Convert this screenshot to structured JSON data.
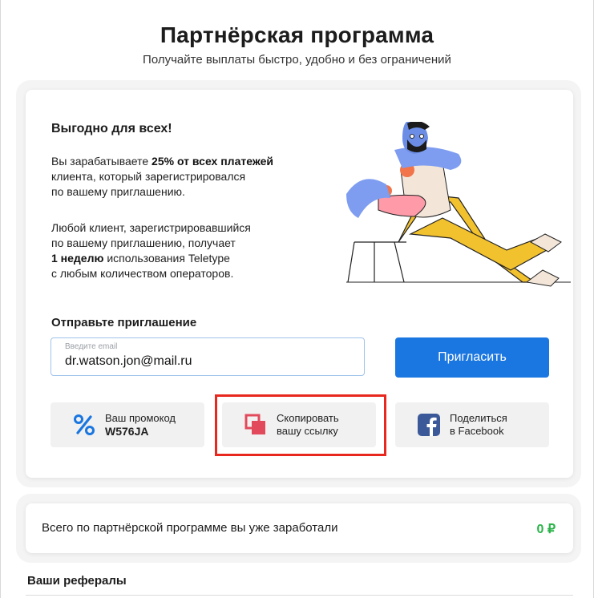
{
  "header": {
    "title": "Партнёрская программа",
    "subtitle": "Получайте выплаты быстро, удобно и без ограничений"
  },
  "benefit": {
    "title": "Выгодно для всех!",
    "p1_before": "Вы зарабатываете ",
    "p1_bold": "25% от всех платежей",
    "p1_after": "\nклиента, который зарегистрировался\nпо вашему приглашению.",
    "p2_before": "Любой клиент, зарегистрировавшийся\nпо вашему приглашению, получает\n",
    "p2_bold": "1 неделю",
    "p2_after": " использования Teletype\nс любым количеством операторов."
  },
  "invite": {
    "label": "Отправьте приглашение",
    "email_caption": "Введите email",
    "email_value": "dr.watson.jon@mail.ru",
    "button_label": "Пригласить"
  },
  "tiles": {
    "promo_label": "Ваш промокод",
    "promo_code": "W576JA",
    "copy_line1": "Скопировать",
    "copy_line2": "вашу ссылку",
    "fb_line1": "Поделиться",
    "fb_line2": "в Facebook"
  },
  "earnings": {
    "label": "Всего по партнёрской программе вы уже заработали",
    "value": "0 ₽"
  },
  "referrals": {
    "title": "Ваши рефералы"
  },
  "colors": {
    "accent": "#1a76e0",
    "highlight": "#e8271e",
    "earned": "#2bb34a",
    "facebook": "#3b5998"
  }
}
